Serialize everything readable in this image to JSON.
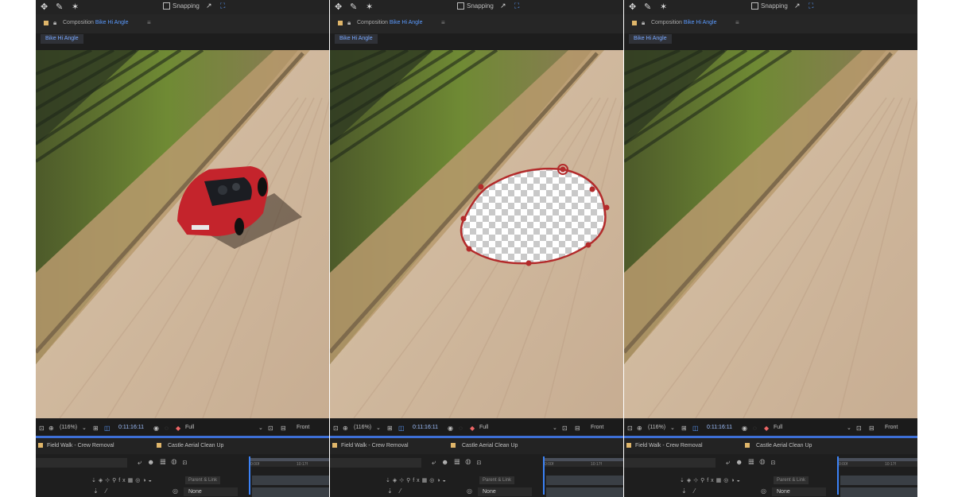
{
  "colors": {
    "panel_bg": "#1d1d1d",
    "accent_blue": "#3d6fd6",
    "comp_name_blue": "#5b9bff",
    "mask_red": "#b32b2b"
  },
  "panels": [
    {
      "toolbar": {
        "snapping_label": "Snapping"
      },
      "comp_header": {
        "prefix": "Composition",
        "name": "Bike Hi Angle"
      },
      "comp_tab": "Bike Hi Angle",
      "status": {
        "zoom": "(116%)",
        "timecode": "0:11:16:11",
        "resolution": "Full",
        "view": "Front"
      },
      "timeline_tabs": [
        "Field Walk - Crew Removal",
        "Castle Aerial Clean Up"
      ],
      "timeline": {
        "parent_link_label": "Parent & Link",
        "parent_value": "None",
        "ruler_start": "0:00f",
        "ruler_mid": "10:17f"
      },
      "scene": "car"
    },
    {
      "toolbar": {
        "snapping_label": "Snapping"
      },
      "comp_header": {
        "prefix": "Composition",
        "name": "Bike Hi Angle"
      },
      "comp_tab": "Bike Hi Angle",
      "status": {
        "zoom": "(116%)",
        "timecode": "0:11:16:11",
        "resolution": "Full",
        "view": "Front"
      },
      "timeline_tabs": [
        "Field Walk - Crew Removal",
        "Castle Aerial Clean Up"
      ],
      "timeline": {
        "parent_link_label": "Parent & Link",
        "parent_value": "None",
        "ruler_start": "0:00f",
        "ruler_mid": "10:17f"
      },
      "scene": "mask"
    },
    {
      "toolbar": {
        "snapping_label": "Snapping"
      },
      "comp_header": {
        "prefix": "Composition",
        "name": "Bike Hi Angle"
      },
      "comp_tab": "Bike Hi Angle",
      "status": {
        "zoom": "(116%)",
        "timecode": "0:11:16:11",
        "resolution": "Full",
        "view": "Front"
      },
      "timeline_tabs": [
        "Field Walk - Crew Removal",
        "Castle Aerial Clean Up"
      ],
      "timeline": {
        "parent_link_label": "Parent & Link",
        "parent_value": "None",
        "ruler_start": "0:00f",
        "ruler_mid": "10:17f"
      },
      "scene": "clean"
    }
  ]
}
